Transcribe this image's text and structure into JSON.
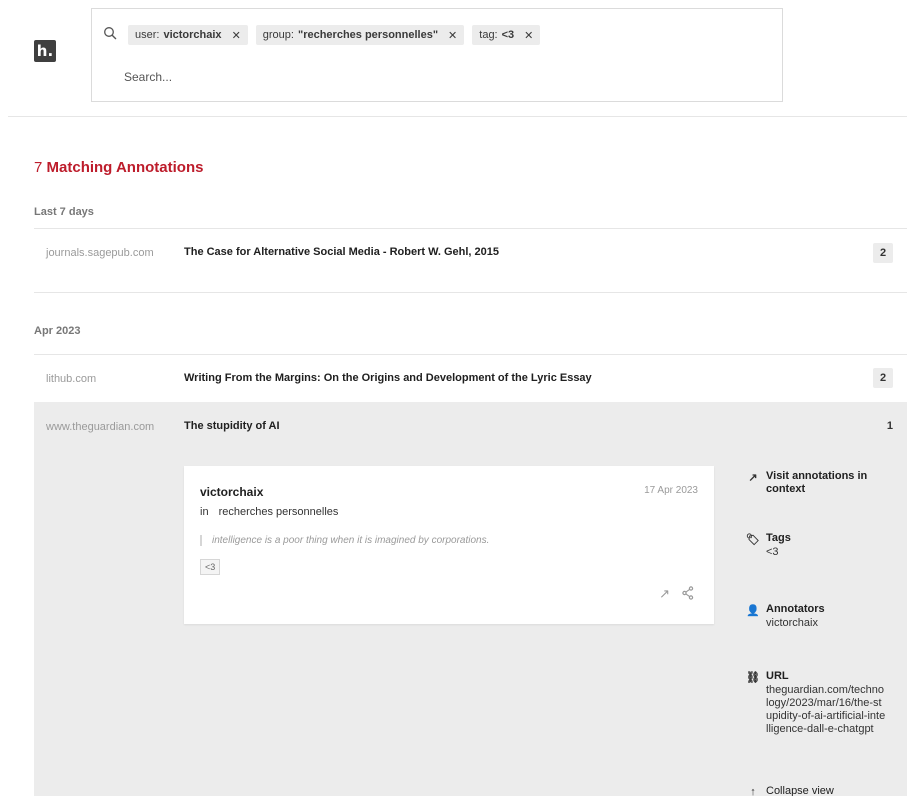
{
  "logo": {
    "text": "h."
  },
  "search": {
    "chips": [
      {
        "key": "user:",
        "value": "victorchaix"
      },
      {
        "key": "group:",
        "value": "\"recherches personnelles\""
      },
      {
        "key": "tag:",
        "value": "<3"
      }
    ],
    "placeholder": "Search..."
  },
  "results": {
    "count": "7",
    "label": "Matching Annotations"
  },
  "sections": [
    {
      "label": "Last 7 days",
      "rows": [
        {
          "domain": "journals.sagepub.com",
          "title": "The Case for Alternative Social Media - Robert W. Gehl, 2015",
          "count": "2"
        }
      ]
    },
    {
      "label": "Apr 2023",
      "rows": [
        {
          "domain": "lithub.com",
          "title": "Writing From the Margins: On the Origins and Development of the Lyric Essay",
          "count": "2"
        },
        {
          "domain": "www.theguardian.com",
          "title": "The stupidity of AI",
          "count": "1"
        }
      ]
    }
  ],
  "annotation": {
    "user": "victorchaix",
    "in": "in",
    "group": "recherches personnelles",
    "date": "17 Apr 2023",
    "quote": "intelligence is a poor thing when it is imagined by corporations.",
    "tag": "<3"
  },
  "details": {
    "visit": "Visit annotations in context",
    "tags_label": "Tags",
    "tags_value": "<3",
    "annotators_label": "Annotators",
    "annotators_value": "victorchaix",
    "url_label": "URL",
    "url_value": "theguardian.com/technology/2023/mar/16/the-stupidity-of-ai-artificial-intelligence-dall-e-chatgpt",
    "collapse": "Collapse view"
  }
}
